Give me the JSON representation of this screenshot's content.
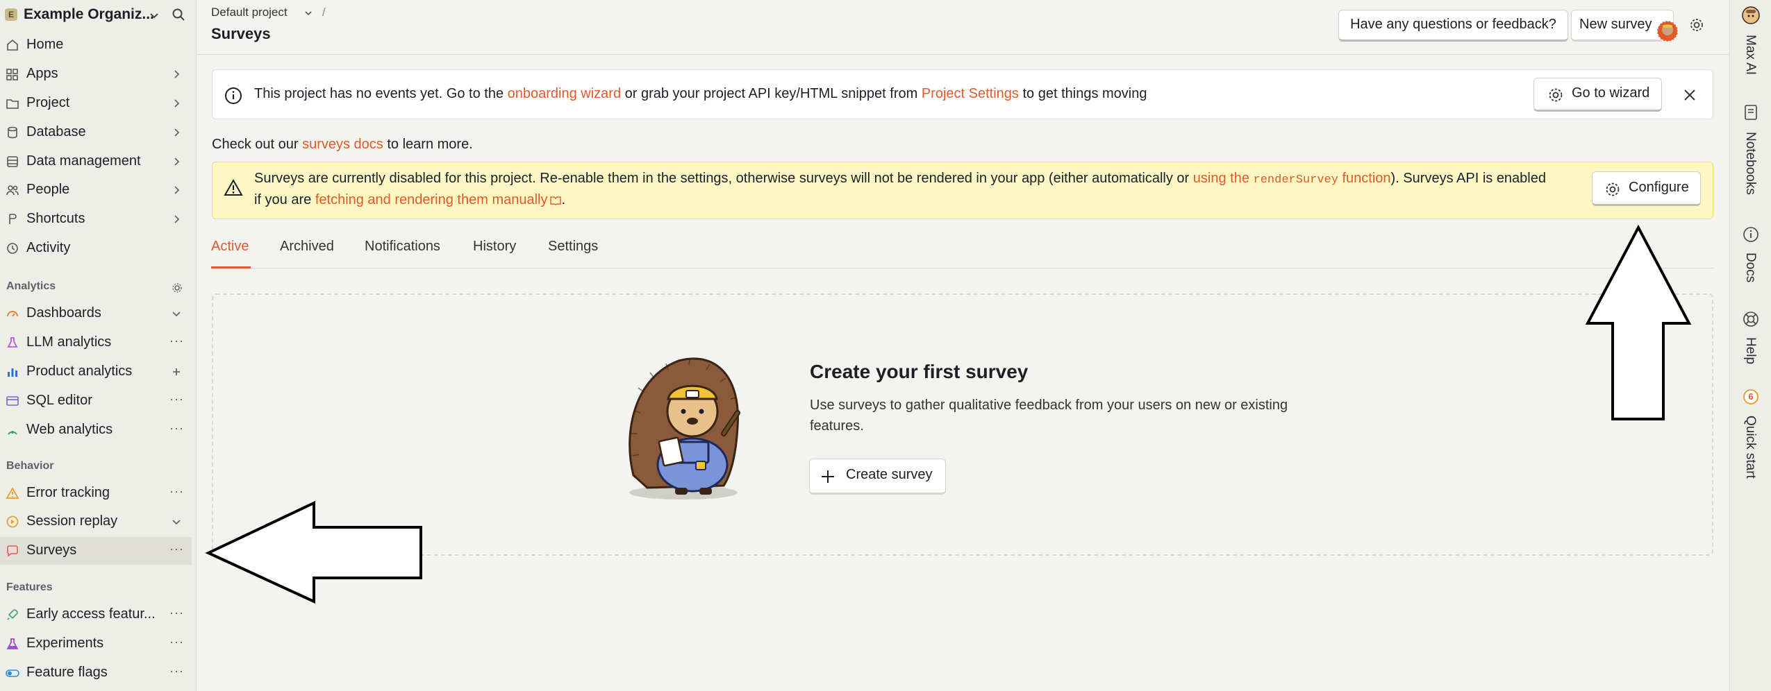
{
  "sidebar": {
    "org_initial": "E",
    "org_name": "Example Organiz...",
    "nav": [
      {
        "label": "Home",
        "icon": "home-icon"
      },
      {
        "label": "Apps",
        "icon": "apps-icon"
      },
      {
        "label": "Project",
        "icon": "folder-icon"
      },
      {
        "label": "Database",
        "icon": "database-icon"
      },
      {
        "label": "Data management",
        "icon": "data-management-icon"
      },
      {
        "label": "People",
        "icon": "people-icon"
      },
      {
        "label": "Shortcuts",
        "icon": "shortcuts-icon"
      },
      {
        "label": "Activity",
        "icon": "activity-icon"
      }
    ],
    "analytics_header": "Analytics",
    "analytics": [
      {
        "label": "Dashboards",
        "icon": "dashboards-icon"
      },
      {
        "label": "LLM analytics",
        "icon": "llm-analytics-icon"
      },
      {
        "label": "Product analytics",
        "icon": "product-analytics-icon"
      },
      {
        "label": "SQL editor",
        "icon": "sql-editor-icon"
      },
      {
        "label": "Web analytics",
        "icon": "web-analytics-icon"
      }
    ],
    "behavior_header": "Behavior",
    "behavior": [
      {
        "label": "Error tracking",
        "icon": "error-tracking-icon"
      },
      {
        "label": "Session replay",
        "icon": "session-replay-icon"
      },
      {
        "label": "Surveys",
        "icon": "surveys-icon"
      }
    ],
    "features_header": "Features",
    "features": [
      {
        "label": "Early access featur...",
        "icon": "rocket-icon"
      },
      {
        "label": "Experiments",
        "icon": "flask-icon"
      },
      {
        "label": "Feature flags",
        "icon": "toggle-icon"
      }
    ]
  },
  "header": {
    "breadcrumb_project": "Default project",
    "breadcrumb_sep": "/",
    "title": "Surveys",
    "feedback_label": "Have any questions or feedback?",
    "new_survey_label": "New survey"
  },
  "banner": {
    "t1": "This project has no events yet. Go to the ",
    "link1": "onboarding wizard",
    "t2": " or grab your project API key/HTML snippet from ",
    "link2": "Project Settings",
    "t3": " to get things moving",
    "wizard_label": "Go to wizard"
  },
  "docs_line": {
    "t1": "Check out our ",
    "link": "surveys docs",
    "t2": " to learn more."
  },
  "warning": {
    "t1": "Surveys are currently disabled for this project. Re-enable them in the settings, otherwise surveys will not be rendered in your app (either automatically or ",
    "link1a": "using the ",
    "code": "renderSurvey",
    "link1b": " function",
    "t2": "). Surveys API is enabled",
    "t3": "if you are ",
    "link2": "fetching and rendering them manually",
    "t4": ".",
    "configure_label": "Configure"
  },
  "tabs": [
    "Active",
    "Archived",
    "Notifications",
    "History",
    "Settings"
  ],
  "empty_state": {
    "title": "Create your first survey",
    "desc_line1": "Use surveys to gather qualitative feedback from your users on new or existing",
    "desc_line2": "features.",
    "button_label": "Create survey"
  },
  "rail": {
    "items": [
      "Max AI",
      "Notebooks",
      "Docs",
      "Help",
      "Quick start"
    ],
    "quick_start_count": "6"
  },
  "colors": {
    "accent": "#e05a2a",
    "warning_bg": "#fdf7c3",
    "page_bg": "#f3f3f0"
  }
}
